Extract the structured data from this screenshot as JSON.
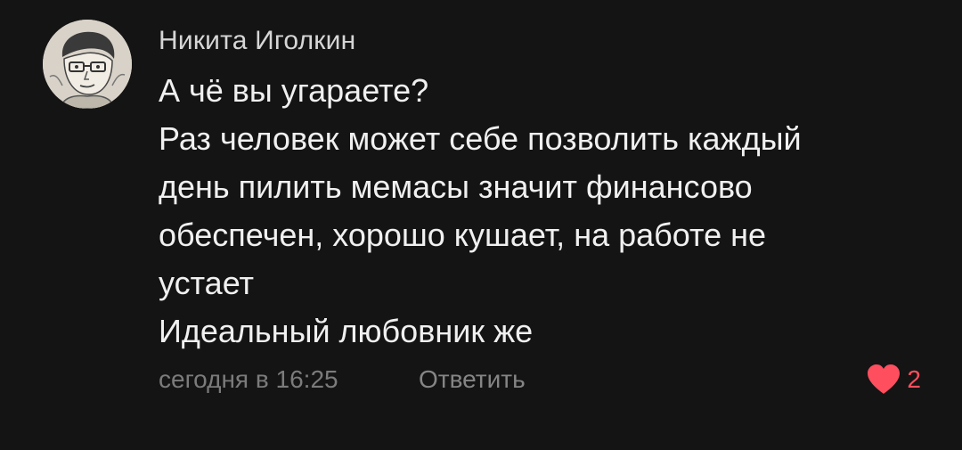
{
  "comment": {
    "author": "Никита Иголкин",
    "avatar_icon": "user-sketch-avatar",
    "text_lines": [
      "А чё вы угараете?",
      "Раз человек может себе позволить каждый",
      "день пилить мемасы значит финансово",
      "обеспечен, хорошо кушает, на работе не",
      "устает",
      "Идеальный любовник же"
    ],
    "timestamp": "сегодня в 16:25",
    "reply_label": "Ответить",
    "like_icon": "heart-icon",
    "like_count": "2",
    "like_color": "#ff4e5e"
  }
}
